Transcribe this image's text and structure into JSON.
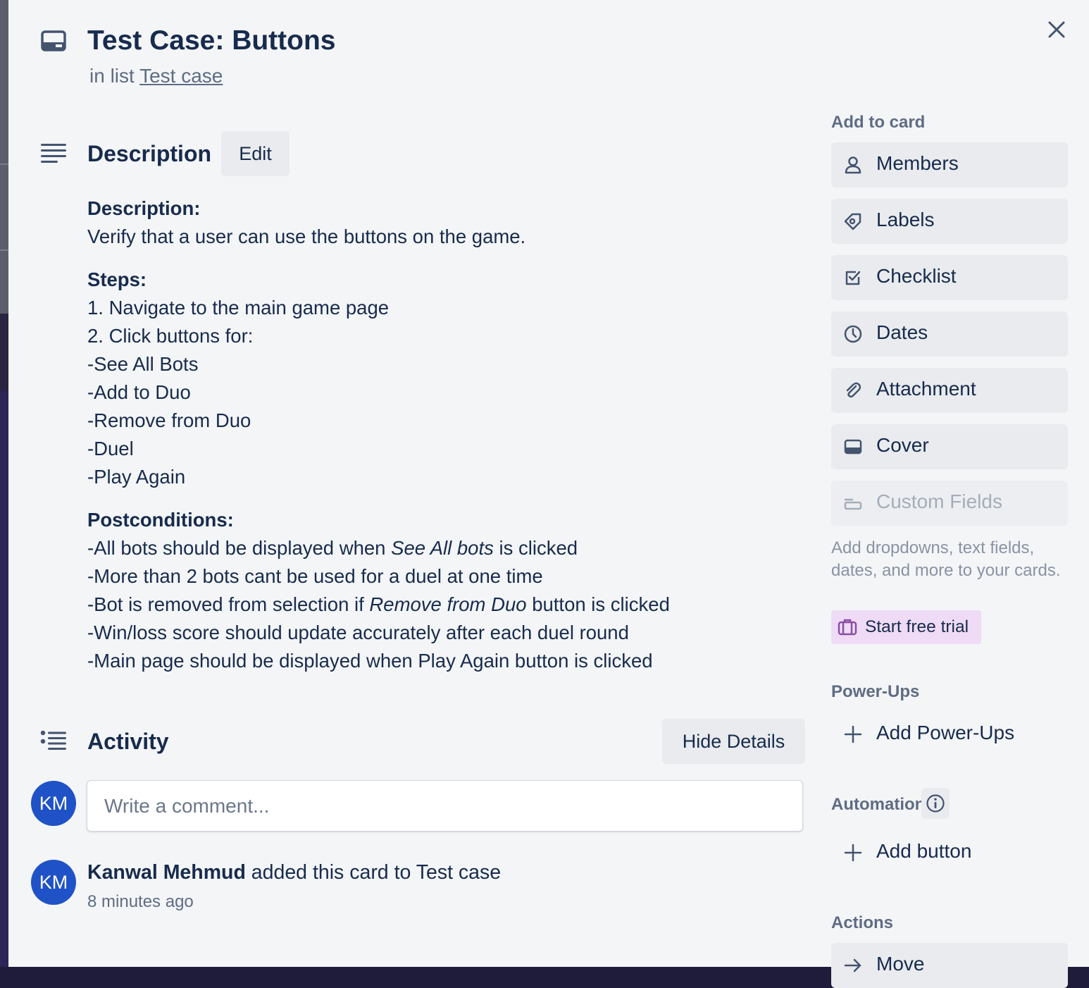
{
  "card": {
    "title": "Test Case: Buttons",
    "in_list_prefix": "in list",
    "list_name": "Test case"
  },
  "description": {
    "heading": "Description",
    "edit_label": "Edit",
    "sections": [
      {
        "label": "Description:",
        "lines": [
          "Verify that a user can use the buttons on the game."
        ]
      },
      {
        "label": "Steps:",
        "lines": [
          "1. Navigate to the main game page",
          "2. Click buttons for:",
          "-See All Bots",
          "-Add to Duo",
          "-Remove from Duo",
          "-Duel",
          "-Play Again"
        ]
      },
      {
        "label": "Postconditions:",
        "lines": []
      }
    ],
    "post_1_before": "-All bots should be displayed when ",
    "post_1_em": "See All bots",
    "post_1_after": " is clicked",
    "post_2": "-More than 2 bots cant be used for a duel at one time",
    "post_3_before": "-Bot is removed from selection if ",
    "post_3_em": "Remove from Duo",
    "post_3_after": " button is clicked",
    "post_4": "-Win/loss score should update accurately after each duel round",
    "post_5": "-Main page should be displayed when Play Again button is clicked"
  },
  "activity": {
    "heading": "Activity",
    "hide_details_label": "Hide Details",
    "comment_placeholder": "Write a comment...",
    "avatar_initials": "KM",
    "entry": {
      "user": "Kanwal Mehmud",
      "action": " added this card to Test case",
      "time": "8 minutes ago"
    }
  },
  "sidebar": {
    "add_to_card_heading": "Add to card",
    "buttons": {
      "members": "Members",
      "labels": "Labels",
      "checklist": "Checklist",
      "dates": "Dates",
      "attachment": "Attachment",
      "cover": "Cover",
      "custom_fields": "Custom Fields"
    },
    "custom_fields_help": "Add dropdowns, text fields, dates, and more to your cards.",
    "trial_label": "Start free trial",
    "powerups_heading": "Power-Ups",
    "add_powerups_label": "Add Power-Ups",
    "automation_heading": "Automation",
    "add_button_label": "Add button",
    "actions_heading": "Actions",
    "move_label": "Move"
  },
  "colors": {
    "text_primary": "#172b4d",
    "text_subtle": "#5e6c84",
    "button_gray": "#e9ebee",
    "avatar_blue": "#1f52c7",
    "trial_purple": "#efdbf6",
    "modal_bg": "#f4f5f7"
  },
  "icons": {
    "header": "card-icon",
    "description": "text-lines-icon",
    "activity": "activity-list-icon",
    "close": "close-icon"
  }
}
